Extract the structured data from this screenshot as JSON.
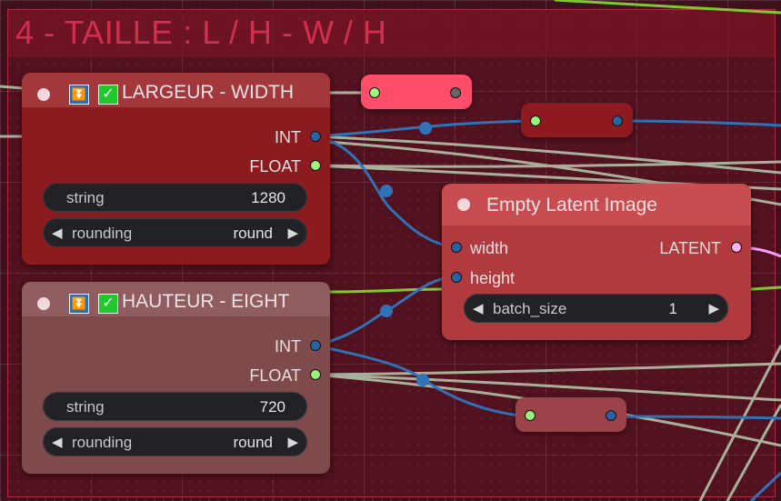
{
  "group": {
    "title": "4 - TAILLE : L / H - W / H",
    "color": "#d0304f"
  },
  "nodes": {
    "width": {
      "title": "LARGEUR - WIDTH",
      "outputs": {
        "int": "INT",
        "float": "FLOAT"
      },
      "widgets": {
        "string": {
          "name": "string",
          "value": "1280"
        },
        "rounding": {
          "name": "rounding",
          "value": "round"
        }
      }
    },
    "height": {
      "title": "HAUTEUR - EIGHT",
      "outputs": {
        "int": "INT",
        "float": "FLOAT"
      },
      "widgets": {
        "string": {
          "name": "string",
          "value": "720"
        },
        "rounding": {
          "name": "rounding",
          "value": "round"
        }
      }
    },
    "latent": {
      "title": "Empty Latent Image",
      "inputs": {
        "width": "width",
        "height": "height"
      },
      "outputs": {
        "latent": "LATENT"
      },
      "widgets": {
        "batch_size": {
          "name": "batch_size",
          "value": "1"
        }
      }
    }
  },
  "icons": {
    "collapse": "double-chevron-down-icon",
    "enabled": "checkmark-icon",
    "decrement": "left-triangle-icon",
    "increment": "right-triangle-icon"
  },
  "colors": {
    "int_link": "#2f72b8",
    "float_link": "#a8b09c",
    "latent_link": "#ff9cf9",
    "green_link": "#7ec92d",
    "float_slot": "#9cf37a",
    "int_slot": "#2a63a0",
    "latent_slot": "#ffb0f0",
    "width_node": "#8c1b1f",
    "height_node": "#7f4a4c",
    "latent_node": "#b03a3e",
    "reroute_pink": "#ff4d6a",
    "reroute_dark": "#8e1a1f",
    "reroute_brown": "#9b4348"
  }
}
